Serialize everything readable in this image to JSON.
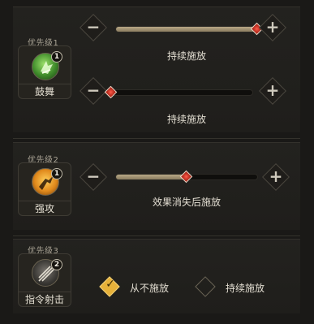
{
  "groups": [
    {
      "priority": "优先级1",
      "skill_name": "鼓舞",
      "badge": "1",
      "icon": "cheer-icon",
      "sliders": [
        {
          "value": 1.0,
          "label": "持续施放"
        },
        {
          "value": 0.0,
          "label": "持续施放"
        }
      ]
    },
    {
      "priority": "优先级2",
      "skill_name": "强攻",
      "badge": "1",
      "icon": "assault-icon",
      "sliders": [
        {
          "value": 0.5,
          "label": "效果消失后施放"
        }
      ]
    },
    {
      "priority": "优先级3",
      "skill_name": "指令射击",
      "badge": "2",
      "icon": "command-shot-icon",
      "options": [
        {
          "label": "从不施放",
          "selected": true
        },
        {
          "label": "持续施放",
          "selected": false
        }
      ]
    }
  ],
  "colors": {
    "fill": "#a8987a",
    "thumb": "#d9392a",
    "check": "#e6b13a"
  }
}
